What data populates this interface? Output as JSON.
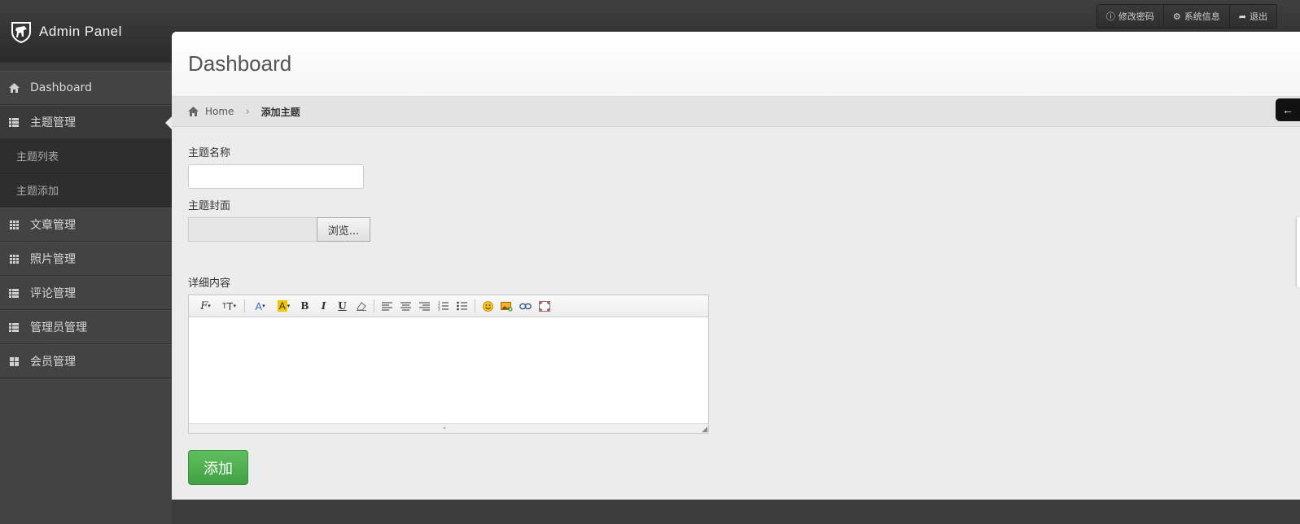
{
  "brand": {
    "title": "Admin Panel",
    "logo_icon": "horse-shield-icon"
  },
  "top_actions": [
    {
      "label": "修改密码",
      "icon": "info-icon"
    },
    {
      "label": "系统信息",
      "icon": "gear-icon"
    },
    {
      "label": "退出",
      "icon": "share-arrow-icon"
    }
  ],
  "sidebar": {
    "items": [
      {
        "label": "Dashboard",
        "icon": "home-icon"
      },
      {
        "label": "主题管理",
        "icon": "list-icon",
        "active": true
      },
      {
        "label": "主题列表",
        "sub": true
      },
      {
        "label": "主题添加",
        "sub": true
      },
      {
        "label": "文章管理",
        "icon": "grid-icon"
      },
      {
        "label": "照片管理",
        "icon": "grid-icon"
      },
      {
        "label": "评论管理",
        "icon": "list-icon"
      },
      {
        "label": "管理员管理",
        "icon": "list-icon"
      },
      {
        "label": "会员管理",
        "icon": "large-grid-icon"
      }
    ]
  },
  "header": {
    "title": "Dashboard"
  },
  "breadcrumb": {
    "home": "Home",
    "current": "添加主题"
  },
  "form": {
    "name_label": "主题名称",
    "name_value": "",
    "cover_label": "主题封面",
    "browse_label": "浏览...",
    "content_label": "详细内容",
    "submit_label": "添加"
  },
  "editor_toolbar": [
    "font-family",
    "font-size",
    "font-color",
    "highlight-color",
    "bold",
    "italic",
    "underline",
    "remove-format",
    "align-left",
    "align-center",
    "align-right",
    "ordered-list",
    "unordered-list",
    "emoticon",
    "insert-image",
    "link",
    "fullscreen"
  ],
  "colors": {
    "accent_green": "#4cae4c",
    "topbar": "#333333",
    "sidebar": "#434343"
  }
}
